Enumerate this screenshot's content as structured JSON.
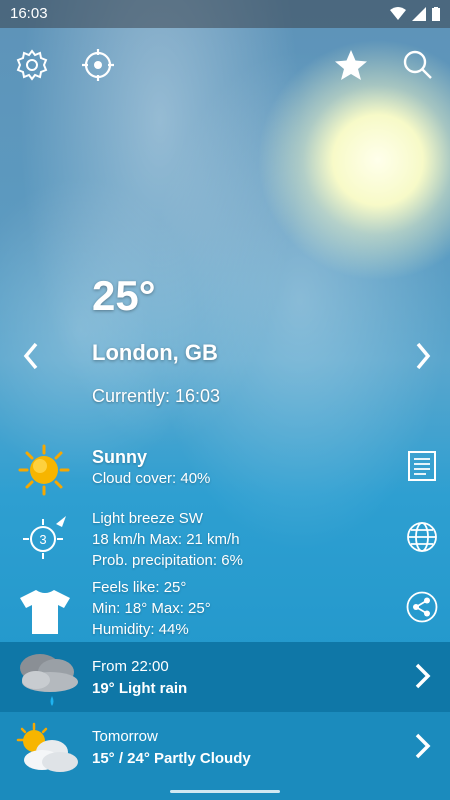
{
  "status_bar": {
    "time": "16:03"
  },
  "header": {
    "settings": "gear-icon",
    "location": "crosshair-icon",
    "favorite": "star-icon",
    "search": "search-icon"
  },
  "current": {
    "temperature": "25°",
    "city": "London, GB",
    "currently": "Currently: 16:03"
  },
  "details": {
    "condition": "Sunny",
    "cloud_cover": "Cloud cover: 40%",
    "wind_title": "Light breeze SW",
    "wind_speed": "18 km/h Max: 21 km/h",
    "precip": "Prob. precipitation: 6%",
    "wind_force": "3",
    "feels_like": "Feels like: 25°",
    "minmax": "Min: 18° Max: 25°",
    "humidity": "Humidity: 44%"
  },
  "forecast": [
    {
      "line1": "From 22:00",
      "line2": "19° Light rain"
    },
    {
      "line1": "Tomorrow",
      "line2": "15° / 24° Partly Cloudy"
    }
  ],
  "colors": {
    "band_dark": "#0f77a7",
    "band_light": "#1b8bbd",
    "sun": "#f7b500"
  }
}
